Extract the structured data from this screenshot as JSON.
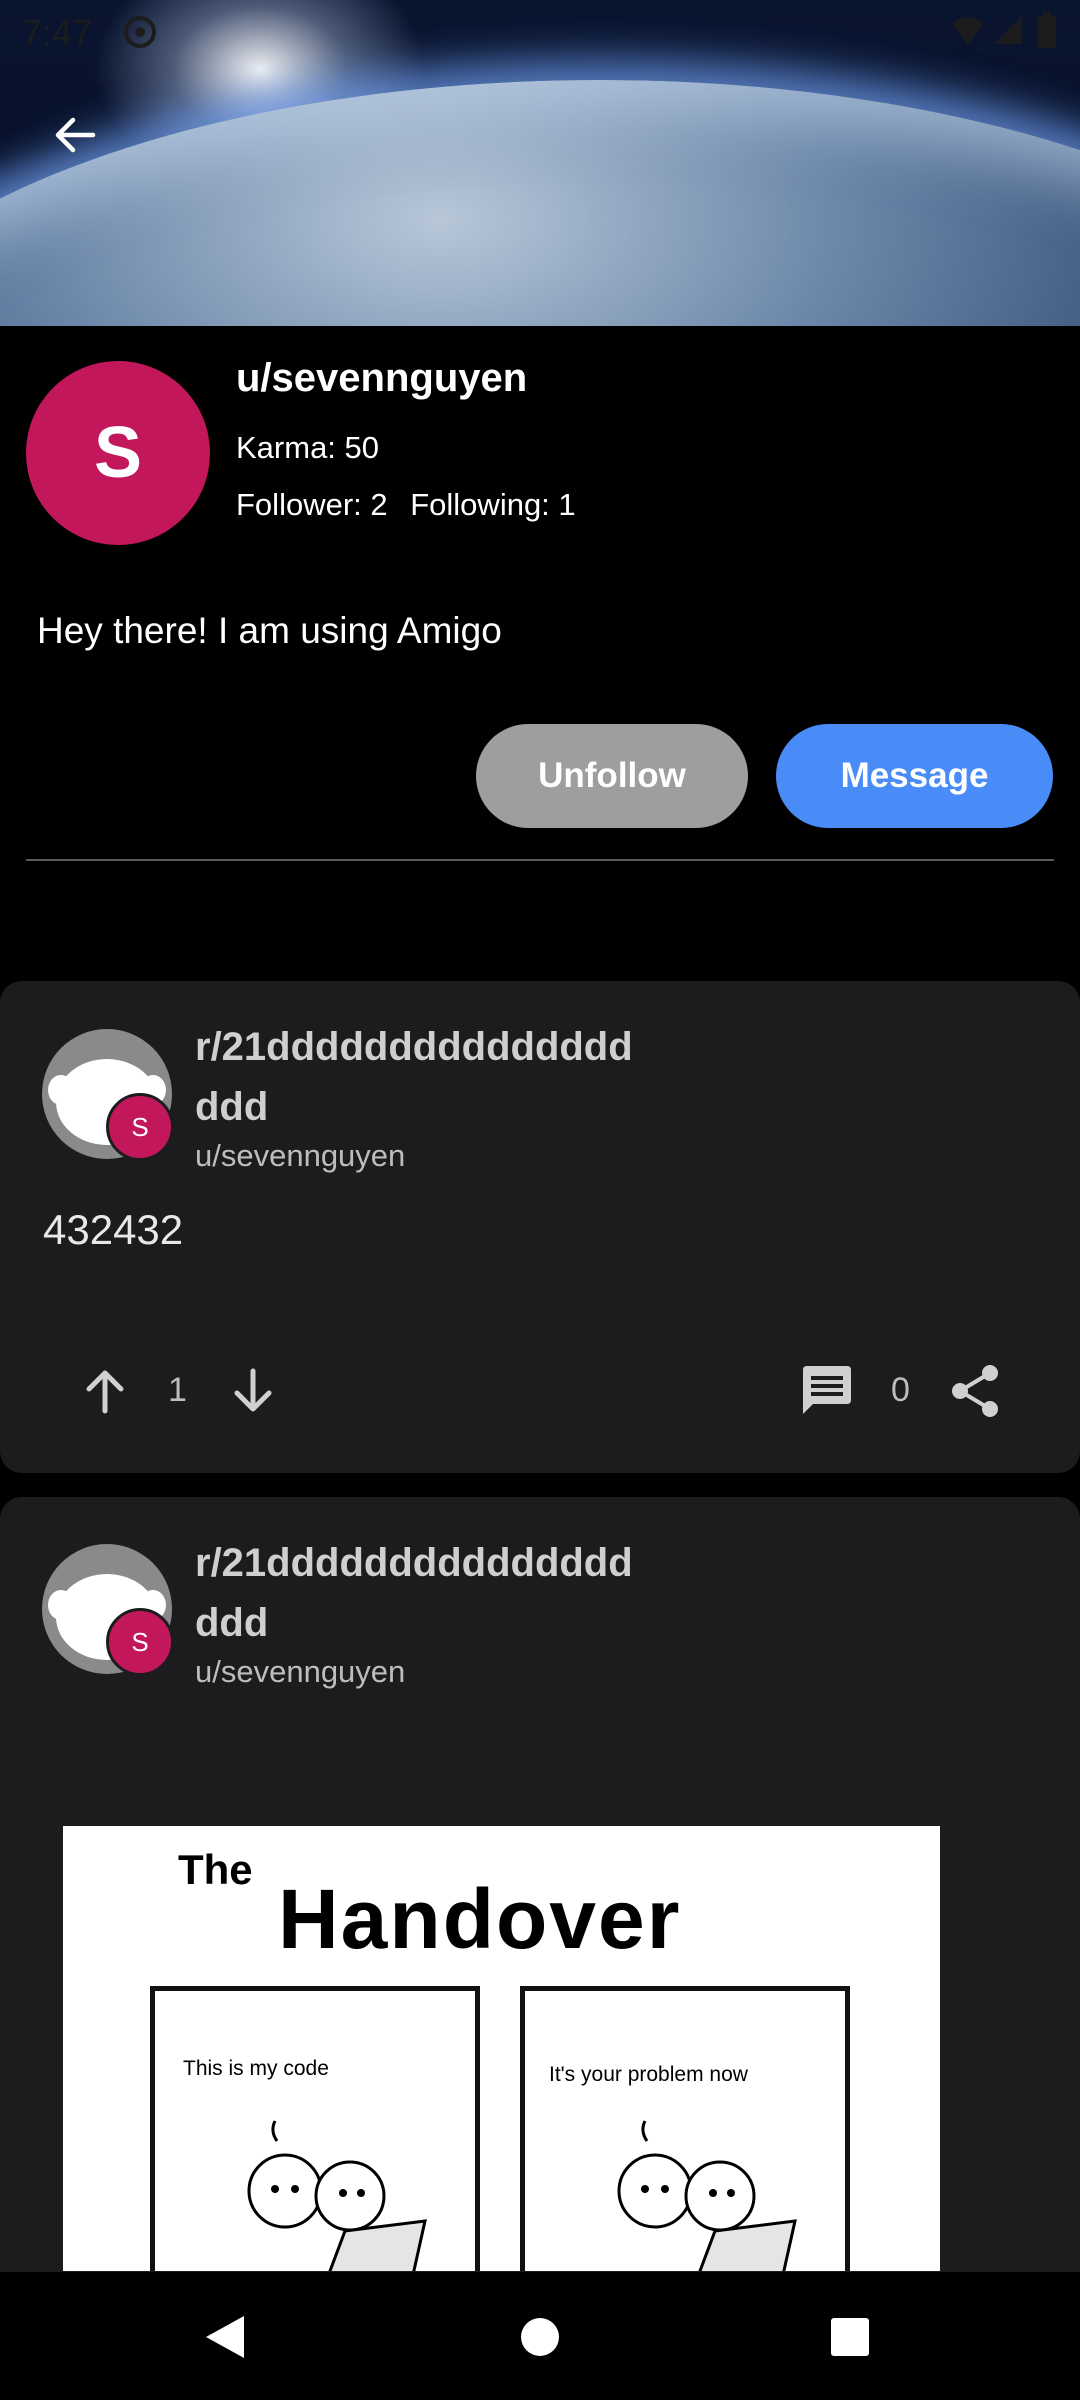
{
  "status": {
    "time": "7:47"
  },
  "profile": {
    "username": "u/sevennguyen",
    "avatar_letter": "S",
    "karma": "Karma: 50",
    "followers": "Follower: 2",
    "following": "Following: 1",
    "bio": "Hey there! I am using Amigo",
    "unfollow_label": "Unfollow",
    "message_label": "Message"
  },
  "posts": [
    {
      "subreddit": "r/21dddddddddddddddddd",
      "author": "u/sevennguyen",
      "avatar_letter": "S",
      "body": "432432",
      "votes": "1",
      "comments": "0"
    },
    {
      "subreddit": "r/21dddddddddddddddddd",
      "author": "u/sevennguyen",
      "avatar_letter": "S",
      "image": {
        "title_small": "The",
        "title_big": "Handover",
        "caption_left": "This is my code",
        "caption_right": "It's your problem now"
      }
    }
  ],
  "colors": {
    "avatar": "#c2185b",
    "message_button": "#4a8cf7",
    "unfollow_button": "#9e9e9e",
    "card": "#1c1c1e"
  },
  "icons": [
    "back-arrow-icon",
    "upvote-icon",
    "downvote-icon",
    "comment-icon",
    "share-icon",
    "nav-back-icon",
    "nav-home-icon",
    "nav-recents-icon"
  ]
}
